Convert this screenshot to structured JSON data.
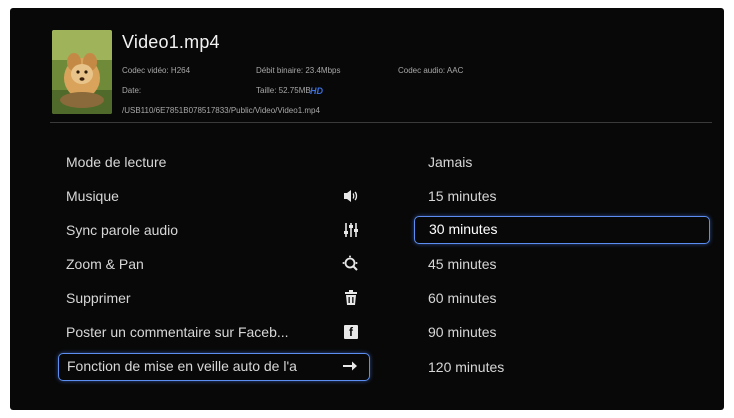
{
  "file": {
    "title": "Video1.mp4",
    "codec_video": "Codec vidéo: H264",
    "bitrate": "Débit binaire: 23.4Mbps",
    "codec_audio": "Codec audio: AAC",
    "date": "Date:",
    "size": "Taille: 52.75MB",
    "quality_badge": "HD",
    "path": "/USB110/6E7851B078517833/Public/Video/Video1.mp4"
  },
  "menu": {
    "items": [
      {
        "label": "Mode de lecture",
        "icon": ""
      },
      {
        "label": "Musique",
        "icon": "speaker-icon"
      },
      {
        "label": "Sync parole audio",
        "icon": "sliders-icon"
      },
      {
        "label": "Zoom & Pan",
        "icon": "zoom-icon"
      },
      {
        "label": "Supprimer",
        "icon": "trash-icon"
      },
      {
        "label": "Poster un commentaire sur Faceb...",
        "icon": "facebook-icon"
      },
      {
        "label": "Fonction de mise en veille auto de l'a",
        "icon": "arrow-right-icon"
      }
    ],
    "selected_index": 6
  },
  "options": {
    "items": [
      "Jamais",
      "15 minutes",
      "30 minutes",
      "45 minutes",
      "60 minutes",
      "90 minutes",
      "120 minutes"
    ],
    "selected_index": 2
  },
  "colors": {
    "background": "#080808",
    "accent": "#5b8ef0",
    "hd_badge": "#3b6fe0"
  }
}
